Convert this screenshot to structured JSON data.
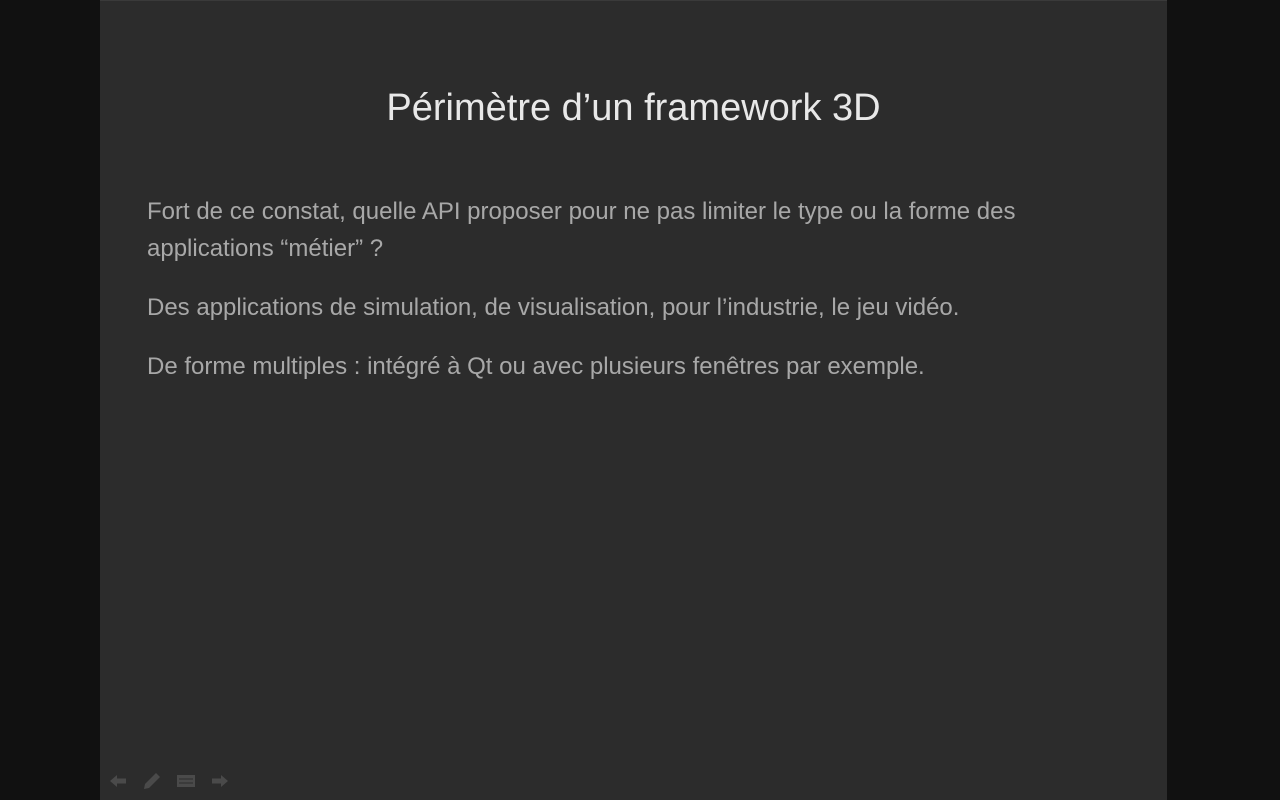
{
  "slide": {
    "title": "Périmètre d’un framework 3D",
    "paragraphs": [
      "Fort de ce constat, quelle API proposer pour ne pas limiter le type ou la forme des applications “métier” ?",
      "Des applications de simulation, de visualisation, pour l’industrie, le jeu vidéo.",
      "De forme multiples : intégré à Qt ou avec plusieurs fenêtres par exemple."
    ]
  },
  "controls": {
    "icons": [
      "arrow-left-icon",
      "pencil-icon",
      "slides-overview-icon",
      "arrow-right-icon"
    ],
    "icon_color": "#4a4a4a"
  },
  "colors": {
    "background": "#111111",
    "slide_background": "#2c2c2c",
    "title": "#e8e8e8",
    "body_text": "#a8a8a8"
  }
}
